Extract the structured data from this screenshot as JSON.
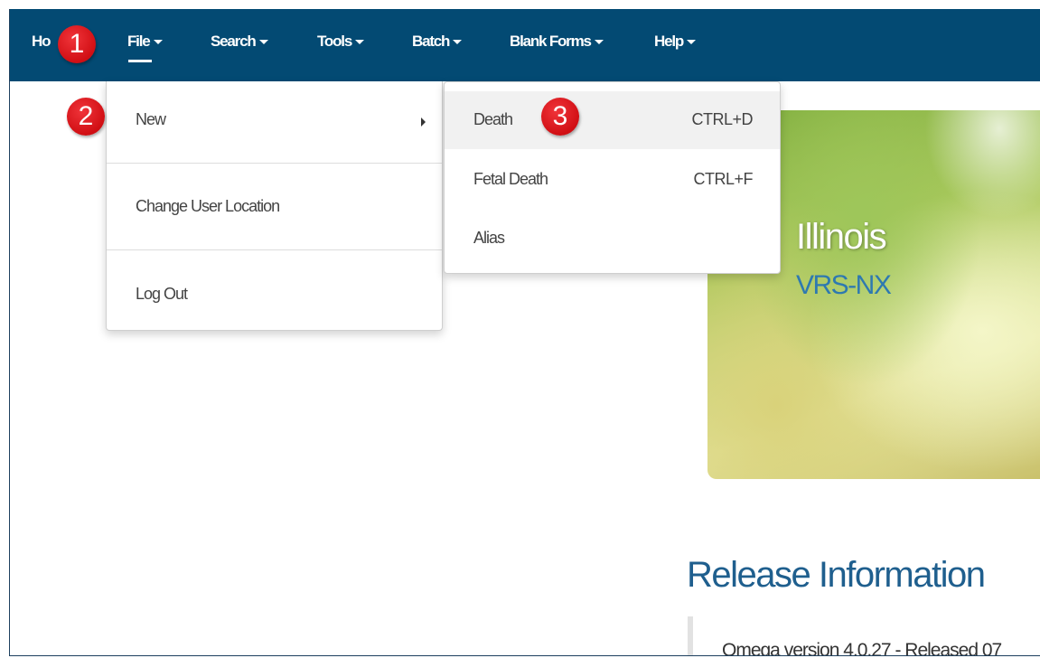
{
  "nav": {
    "home": "Ho",
    "file": "File",
    "search": "Search",
    "tools": "Tools",
    "batch": "Batch",
    "blank_forms": "Blank Forms",
    "help": "Help"
  },
  "file_menu": {
    "new": "New",
    "change_location": "Change User Location",
    "log_out": "Log Out"
  },
  "new_submenu": [
    {
      "label": "Death",
      "shortcut": "CTRL+D"
    },
    {
      "label": "Fetal Death",
      "shortcut": "CTRL+F"
    },
    {
      "label": "Alias",
      "shortcut": ""
    }
  ],
  "badges": [
    "1",
    "2",
    "3"
  ],
  "hero": {
    "title": "Illinois",
    "subtitle": "VRS-NX"
  },
  "release": {
    "title": "Release Information",
    "version_text": "Omega version 4.0.27 - Released 07"
  },
  "colors": {
    "navbar": "#034a73",
    "badge": "#d10f14",
    "accent": "#1f5f8e"
  }
}
